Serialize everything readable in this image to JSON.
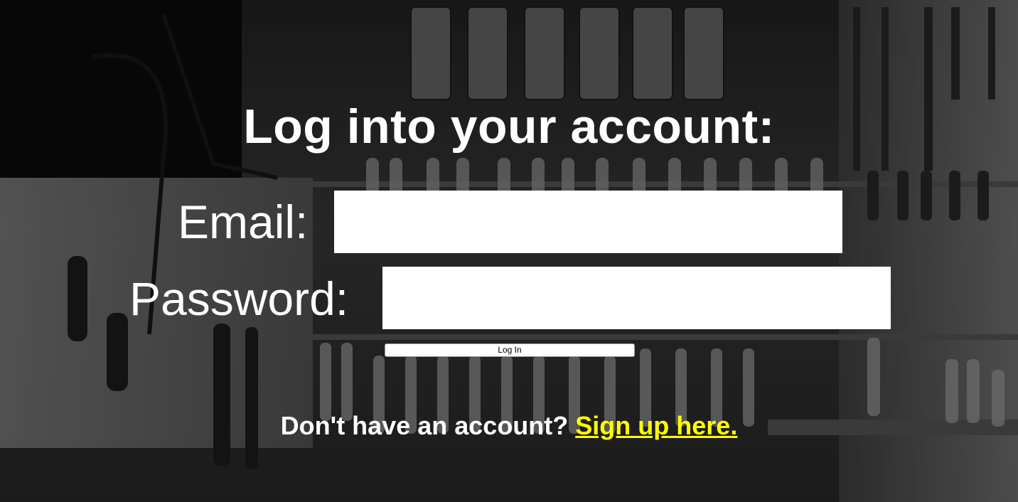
{
  "page": {
    "title": "Log into your account:"
  },
  "form": {
    "email_label": "Email:",
    "email_value": "",
    "password_label": "Password:",
    "password_value": "",
    "login_button_label": "Log In"
  },
  "signup": {
    "prompt_text": "Don't have an account?",
    "link_text": "Sign up here."
  },
  "colors": {
    "text": "#ffffff",
    "link": "#ffff00",
    "input_background": "#ffffff"
  },
  "background": {
    "description_icon": "workshop-tools-wall-image"
  }
}
